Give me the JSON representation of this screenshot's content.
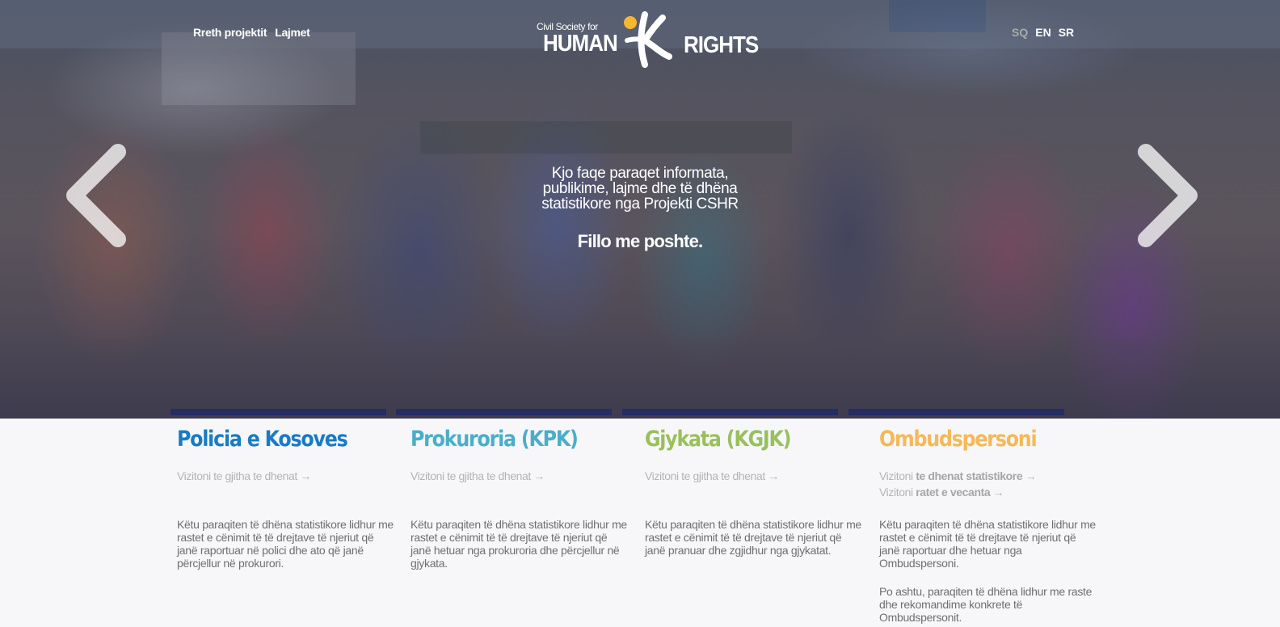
{
  "nav": {
    "items": [
      {
        "label": "Rreth projektit"
      },
      {
        "label": "Lajmet"
      }
    ]
  },
  "logo": {
    "line1": "Civil Society for",
    "line2": "HUMAN",
    "line3": "RIGHTS",
    "accent_color": "#f5b731"
  },
  "languages": [
    {
      "label": "SQ",
      "active": true,
      "color": "#a9a9ad"
    },
    {
      "label": "EN",
      "active": false,
      "color": "#ffffff"
    },
    {
      "label": "SR",
      "active": false,
      "color": "#ffffff"
    }
  ],
  "hero": {
    "tagline_lines": [
      "Kjo faqe paraqet informata,",
      "publikime, lajme dhe të dhëna",
      "statistikore nga Projekti CSHR"
    ],
    "cta": "Fillo me poshte.",
    "prev_icon": "chevron-left-icon",
    "next_icon": "chevron-right-icon"
  },
  "sections": [
    {
      "title": "Policia e Kosoves",
      "color": "#1a7bc4",
      "links": [
        {
          "prefix": "Vizitoni te gjitha te dhenat",
          "bold": "",
          "arrow": "→"
        }
      ],
      "paragraphs": [
        "Këtu paraqiten të dhëna statistikore lidhur me rastet e cënimit të të drejtave të njeriut që janë raportuar në polici dhe ato që janë përcjellur në prokurori."
      ]
    },
    {
      "title": "Prokuroria (KPK)",
      "color": "#4aaec9",
      "links": [
        {
          "prefix": "Vizitoni te gjitha te dhenat",
          "bold": "",
          "arrow": "→"
        }
      ],
      "paragraphs": [
        "Këtu paraqiten të dhëna statistikore lidhur me rastet e cënimit të të drejtave të njeriut që janë hetuar nga prokuroria dhe përcjellur në gjykata."
      ]
    },
    {
      "title": "Gjykata (KGJK)",
      "color": "#98c05c",
      "links": [
        {
          "prefix": "Vizitoni te gjitha te dhenat",
          "bold": "",
          "arrow": "→"
        }
      ],
      "paragraphs": [
        "Këtu paraqiten të dhëna statistikore lidhur me rastet e cënimit të të drejtave të njeriut që janë pranuar dhe zgjidhur nga gjykatat."
      ]
    },
    {
      "title": "Ombudspersoni",
      "color": "#f5b95a",
      "links": [
        {
          "prefix": "Vizitoni",
          "bold": "te dhenat statistikore",
          "arrow": "→"
        },
        {
          "prefix": "Vizitoni",
          "bold": "ratet e vecanta",
          "arrow": "→"
        }
      ],
      "paragraphs": [
        "Këtu paraqiten të dhëna statistikore lidhur me rastet e cënimit të të drejtave të njeriut që janë raportuar dhe hetuar nga Ombudspersoni.",
        "Po ashtu, paraqiten të dhëna lidhur me raste dhe rekomandime konkrete të Ombudspersonit."
      ]
    }
  ]
}
